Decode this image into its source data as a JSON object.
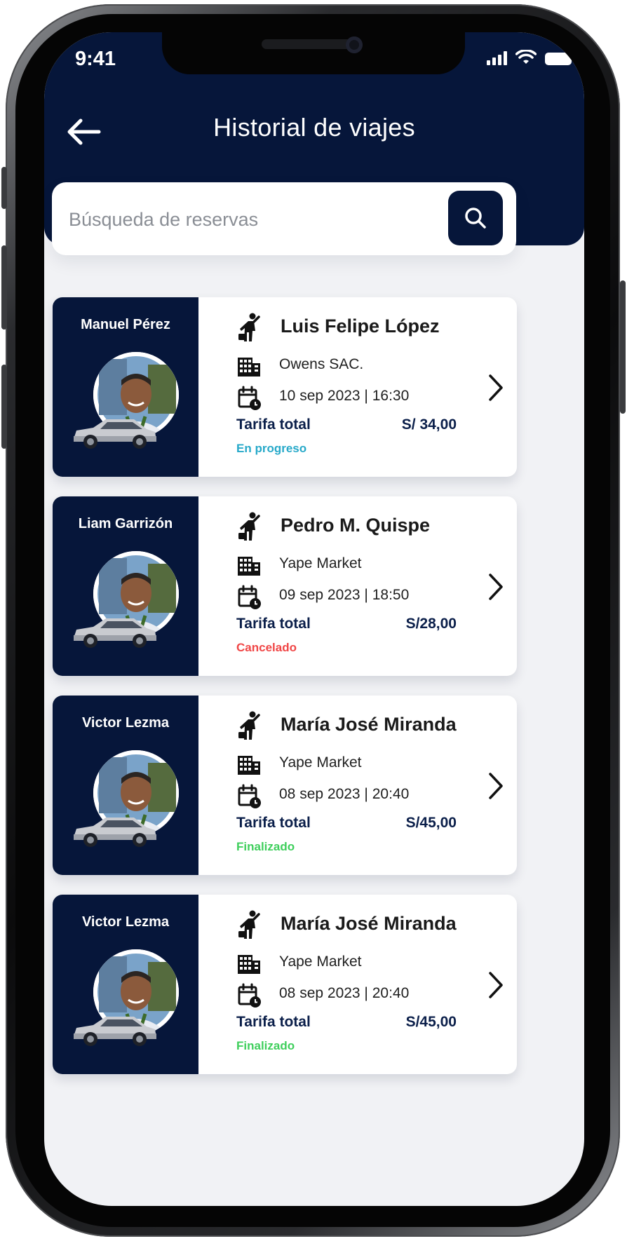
{
  "status_bar": {
    "time": "9:41"
  },
  "header": {
    "title": "Historial de viajes"
  },
  "search": {
    "placeholder": "Búsqueda de reservas"
  },
  "trips": [
    {
      "driver": "Manuel Pérez",
      "passenger": "Luis Felipe López",
      "company": "Owens SAC.",
      "datetime": "10 sep 2023 | 16:30",
      "fare_label": "Tarifa total",
      "fare": "S/ 34,00",
      "status": "En progreso",
      "status_color": "#27a9c9"
    },
    {
      "driver": "Liam Garrizón",
      "passenger": "Pedro M. Quispe",
      "company": "Yape Market",
      "datetime": "09 sep 2023 | 18:50",
      "fare_label": "Tarifa total",
      "fare": "S/28,00",
      "status": "Cancelado",
      "status_color": "#f04646"
    },
    {
      "driver": "Victor Lezma",
      "passenger": "María José Miranda",
      "company": "Yape Market",
      "datetime": "08 sep 2023 | 20:40",
      "fare_label": "Tarifa total",
      "fare": "S/45,00",
      "status": "Finalizado",
      "status_color": "#3fcf5c"
    },
    {
      "driver": "Victor Lezma",
      "passenger": "María José Miranda",
      "company": "Yape Market",
      "datetime": "08 sep 2023 | 20:40",
      "fare_label": "Tarifa total",
      "fare": "S/45,00",
      "status": "Finalizado",
      "status_color": "#3fcf5c"
    }
  ],
  "colors": {
    "navy": "#06163a",
    "background": "#f1f2f5"
  },
  "icons": {
    "back": "arrow-left-icon",
    "search": "search-icon",
    "passenger": "person-walking-icon",
    "company": "building-icon",
    "date": "calendar-clock-icon",
    "open": "chevron-right-icon"
  }
}
